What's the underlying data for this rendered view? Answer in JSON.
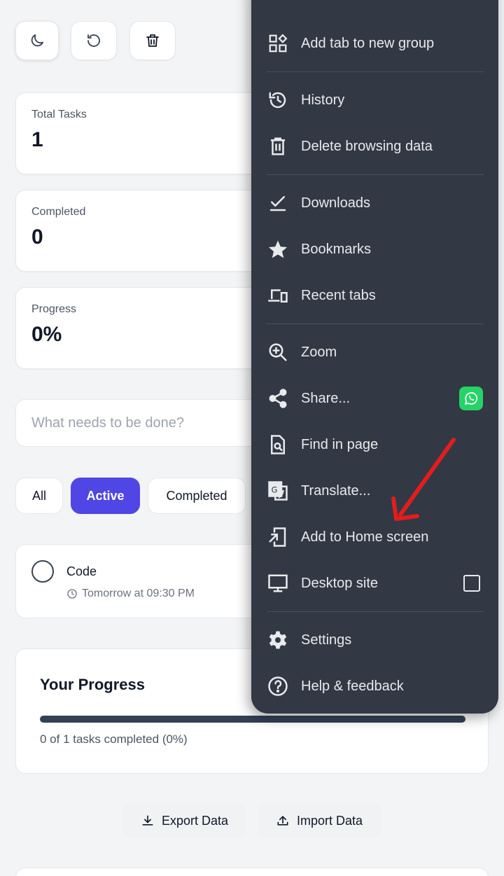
{
  "toolbar": {
    "theme_icon": "moon-icon",
    "reset_icon": "reset-icon",
    "delete_icon": "trash-icon"
  },
  "stats": [
    {
      "label": "Total Tasks",
      "value": "1"
    },
    {
      "label": "Completed",
      "value": "0"
    },
    {
      "label": "Progress",
      "value": "0%"
    }
  ],
  "task_input": {
    "placeholder": "What needs to be done?"
  },
  "filters": {
    "all": "All",
    "active": "Active",
    "completed": "Completed"
  },
  "task": {
    "title": "Code",
    "due": "Tomorrow at 09:30 PM",
    "done": false
  },
  "progress": {
    "title": "Your Progress",
    "fraction": 0,
    "text": "0 of 1 tasks completed (0%)"
  },
  "data_actions": {
    "export": "Export Data",
    "import": "Import Data"
  },
  "menu": {
    "items": [
      {
        "label": "Add tab to new group",
        "icon": "tab-group-icon"
      },
      {
        "label": "History",
        "icon": "history-icon"
      },
      {
        "label": "Delete browsing data",
        "icon": "trash-icon"
      },
      {
        "label": "Downloads",
        "icon": "download-check-icon"
      },
      {
        "label": "Bookmarks",
        "icon": "star-icon"
      },
      {
        "label": "Recent tabs",
        "icon": "devices-icon"
      },
      {
        "label": "Zoom",
        "icon": "zoom-icon"
      },
      {
        "label": "Share...",
        "icon": "share-icon"
      },
      {
        "label": "Find in page",
        "icon": "find-icon"
      },
      {
        "label": "Translate...",
        "icon": "translate-icon"
      },
      {
        "label": "Add to Home screen",
        "icon": "add-to-home-icon"
      },
      {
        "label": "Desktop site",
        "icon": "desktop-icon"
      },
      {
        "label": "Settings",
        "icon": "gear-icon"
      },
      {
        "label": "Help & feedback",
        "icon": "help-icon"
      }
    ],
    "share_target_icon": "whatsapp-icon",
    "desktop_site_checked": false
  },
  "colors": {
    "accent": "#4f46e5",
    "menu_bg": "#323844",
    "annotation_arrow": "#e11d1d",
    "whatsapp": "#25d366"
  }
}
